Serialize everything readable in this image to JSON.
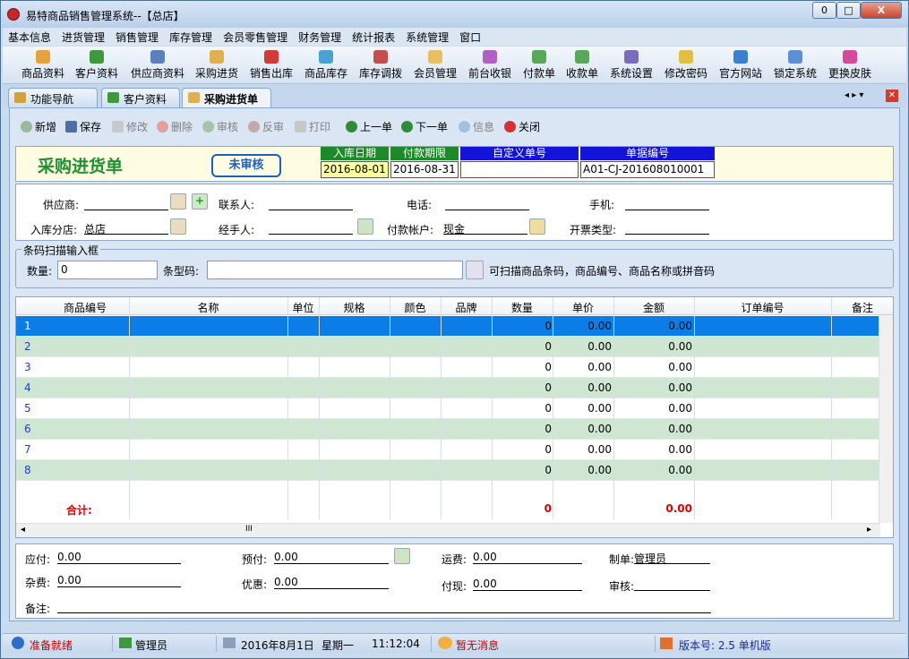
{
  "window": {
    "title": "易特商品销售管理系统--【总店】",
    "min": "0",
    "max": "□",
    "close": "X"
  },
  "menu": [
    "基本信息",
    "进货管理",
    "销售管理",
    "库存管理",
    "会员零售管理",
    "财务管理",
    "统计报表",
    "系统管理",
    "窗口"
  ],
  "toolbar": [
    "商品资料",
    "客户资料",
    "供应商资料",
    "采购进货",
    "销售出库",
    "商品库存",
    "库存调拨",
    "会员管理",
    "前台收银",
    "付款单",
    "收款单",
    "系统设置",
    "修改密码",
    "官方网站",
    "锁定系统",
    "更换皮肤"
  ],
  "tabs": [
    "功能导航",
    "客户资料",
    "采购进货单"
  ],
  "actions": [
    {
      "label": "新增",
      "enabled": true
    },
    {
      "label": "保存",
      "enabled": true
    },
    {
      "label": "修改",
      "enabled": false
    },
    {
      "label": "删除",
      "enabled": false
    },
    {
      "label": "审核",
      "enabled": false
    },
    {
      "label": "反审",
      "enabled": false
    },
    {
      "label": "打印",
      "enabled": false
    },
    {
      "label": "上一单",
      "enabled": true
    },
    {
      "label": "下一单",
      "enabled": true
    },
    {
      "label": "信息",
      "enabled": false
    },
    {
      "label": "关闭",
      "enabled": true
    }
  ],
  "form": {
    "title": "采购进货单",
    "status": "未审核",
    "date_labels": [
      "入库日期",
      "付款期限",
      "自定义单号",
      "单据编号"
    ],
    "date_values": [
      "2016-08-01",
      "2016-08-31",
      "",
      "A01-CJ-201608010001"
    ],
    "supplier_label": "供应商:",
    "supplier": "",
    "contact_label": "联系人:",
    "contact": "",
    "phone_label": "电话:",
    "phone": "",
    "mobile_label": "手机:",
    "mobile": "",
    "branch_label": "入库分店:",
    "branch": "总店",
    "handler_label": "经手人:",
    "handler": "",
    "account_label": "付款帐户:",
    "account": "现金",
    "invoice_label": "开票类型:",
    "invoice": ""
  },
  "scan": {
    "legend": "条码扫描输入框",
    "qty_label": "数量:",
    "qty": "0",
    "barcode_label": "条型码:",
    "barcode": "",
    "hint": "可扫描商品条码，商品编号、商品名称或拼音码"
  },
  "grid": {
    "columns": [
      "商品编号",
      "名称",
      "单位",
      "规格",
      "颜色",
      "品牌",
      "数量",
      "单价",
      "金额",
      "订单编号",
      "备注"
    ],
    "rows": [
      {
        "n": "1",
        "qty": "0",
        "price": "0.00",
        "amount": "0.00"
      },
      {
        "n": "2",
        "qty": "0",
        "price": "0.00",
        "amount": "0.00"
      },
      {
        "n": "3",
        "qty": "0",
        "price": "0.00",
        "amount": "0.00"
      },
      {
        "n": "4",
        "qty": "0",
        "price": "0.00",
        "amount": "0.00"
      },
      {
        "n": "5",
        "qty": "0",
        "price": "0.00",
        "amount": "0.00"
      },
      {
        "n": "6",
        "qty": "0",
        "price": "0.00",
        "amount": "0.00"
      },
      {
        "n": "7",
        "qty": "0",
        "price": "0.00",
        "amount": "0.00"
      },
      {
        "n": "8",
        "qty": "0",
        "price": "0.00",
        "amount": "0.00"
      }
    ],
    "total_label": "合计:",
    "total_qty": "0",
    "total_amount": "0.00",
    "hscroll_thumb": "III"
  },
  "footer": {
    "payable_label": "应付:",
    "payable": "0.00",
    "prepay_label": "预付:",
    "prepay": "0.00",
    "freight_label": "运费:",
    "freight": "0.00",
    "maker_label": "制单:",
    "maker": "管理员",
    "misc_label": "杂费:",
    "misc": "0.00",
    "discount_label": "优惠:",
    "discount": "0.00",
    "cash_label": "付现:",
    "cash": "0.00",
    "audit_label": "审核:",
    "audit": "",
    "note_label": "备注:",
    "note": ""
  },
  "status": {
    "ready": "准备就绪",
    "user": "管理员",
    "date": "2016年8月1日",
    "weekday": "星期一",
    "time": "11:12:04",
    "msg": "暂无消息",
    "version": "版本号: 2.5 单机版"
  },
  "colors": {
    "green_head": "#1d8a29",
    "blue_head": "#1414d8",
    "selected_row": "#0a7ee6",
    "alt_row": "#cfe6d3",
    "total": "#e00000"
  }
}
